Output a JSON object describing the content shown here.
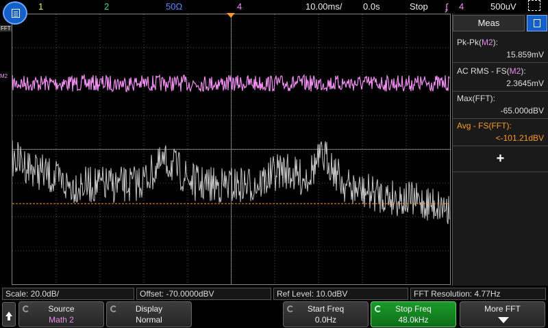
{
  "top_bar": {
    "ch1": "1",
    "ch2": "2",
    "ch3": "50Ω",
    "ch4": "4",
    "timebase": "10.00ms/",
    "delay": "0.0s",
    "run_state": "Stop",
    "trigger_channel": "4",
    "trigger_level": "500uV"
  },
  "markers": {
    "fft": "FFT",
    "m2": "M2"
  },
  "measurements": {
    "title": "Meas",
    "items": [
      {
        "label_prefix": "Pk-Pk(",
        "label_src": "M2",
        "label_suffix": "):",
        "value": "15.859mV"
      },
      {
        "label_prefix": "AC RMS - FS(",
        "label_src": "M2",
        "label_suffix": "):",
        "value": "2.3645mV"
      },
      {
        "label_prefix": "Max(",
        "label_src": "FFT",
        "label_suffix": "):",
        "value": "-65.000dBV"
      },
      {
        "label_prefix": "Avg - FS(",
        "label_src": "FFT",
        "label_suffix": "):",
        "value": "<-101.21dBV"
      }
    ],
    "add_symbol": "+"
  },
  "info_row": {
    "scale": "Scale: 20.0dB/",
    "offset": "Offset: -70.0000dBV",
    "ref_level": "Ref Level: 10.0dBV",
    "fft_resolution": "FFT Resolution: 4.77Hz"
  },
  "softkeys": {
    "source_label": "Source",
    "source_value": "Math 2",
    "display_label": "Display",
    "display_value": "Normal",
    "start_label": "Start Freq",
    "start_value": "0.0Hz",
    "stop_label": "Stop Freq",
    "stop_value": "48.0kHz",
    "more_label": "More FFT"
  },
  "colors": {
    "m2_trace": "#f08ef2",
    "fft_trace": "#c8c8c8",
    "ch1": "#f3f34a",
    "ch2": "#3ee06a",
    "ch3": "#5a8cff",
    "ch4": "#f08ef2",
    "avg_line": "#ff9a2a",
    "grid": "#555555"
  }
}
